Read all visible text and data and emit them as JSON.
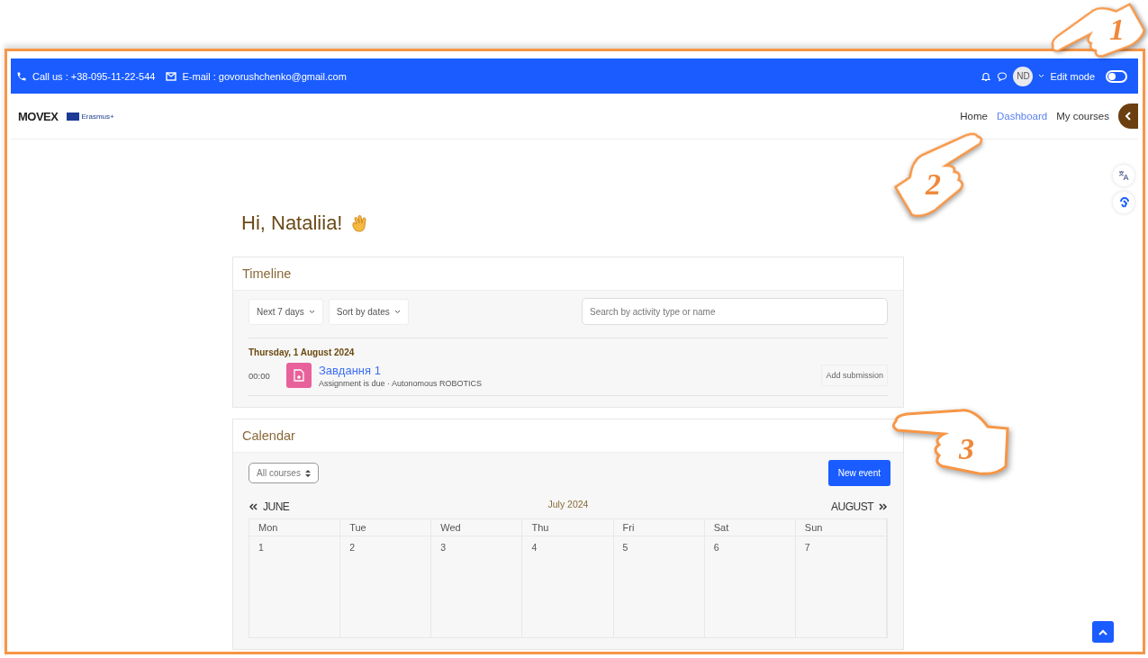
{
  "contact_bar": {
    "phone": "Call us : +38-095-11-22-544",
    "email": "E-mail : govorushchenko@gmail.com",
    "avatar": "ND",
    "edit_mode": {
      "label": "Edit mode",
      "on": false
    }
  },
  "header": {
    "logo": "MOVEX",
    "partner": "Erasmus+",
    "nav": [
      {
        "label": "Home",
        "selected": false
      },
      {
        "label": "Dashboard",
        "selected": true
      },
      {
        "label": "My courses",
        "selected": false
      }
    ]
  },
  "greeting": "Hi, Nataliia!",
  "timeline": {
    "title": "Timeline",
    "filters": [
      "Next 7 days",
      "Sort by dates"
    ],
    "search": {
      "placeholder": "Search by activity type or name"
    },
    "date": "Thursday, 1 August 2024",
    "events": [
      {
        "time": "00:00",
        "title": "Завдання 1",
        "subtitle": "Assignment is due · Autonomous ROBOTICS",
        "action": "Add submission"
      }
    ]
  },
  "calendar": {
    "title": "Calendar",
    "course_filter": "All courses",
    "new_event": "New event",
    "prev": "JUNE",
    "month": "July 2024",
    "next": "AUGUST",
    "weekdays": [
      "Mon",
      "Tue",
      "Wed",
      "Thu",
      "Fri",
      "Sat",
      "Sun"
    ],
    "weeks": [
      [
        "1",
        "2",
        "3",
        "4",
        "5",
        "6",
        "7"
      ]
    ]
  },
  "annotations": [
    {
      "label": "1"
    },
    {
      "label": "2"
    },
    {
      "label": "3"
    }
  ]
}
